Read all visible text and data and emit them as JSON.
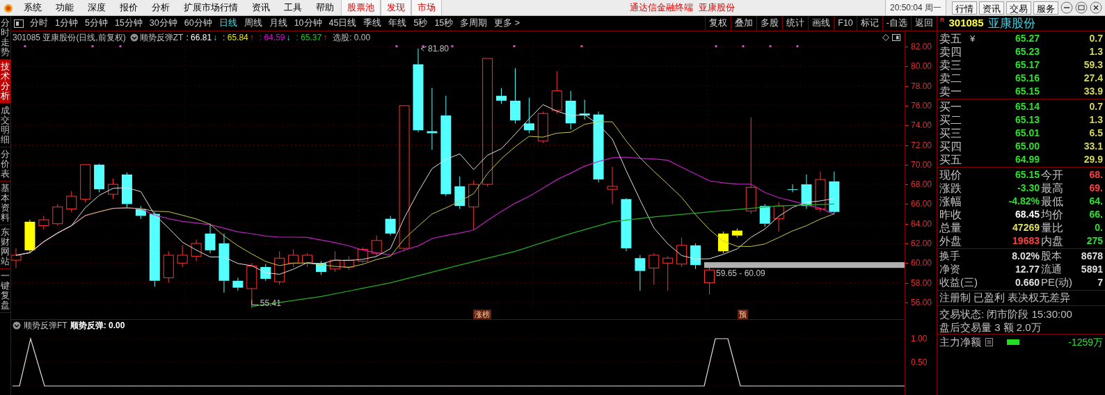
{
  "menu_bar": {
    "items": [
      {
        "label": "系统",
        "kind": "plain"
      },
      {
        "label": "功能",
        "kind": "plain"
      },
      {
        "label": "深度",
        "kind": "plain"
      },
      {
        "label": "报价",
        "kind": "plain"
      },
      {
        "label": "分析",
        "kind": "plain"
      },
      {
        "label": "扩展市场行情",
        "kind": "plain"
      },
      {
        "label": "资讯",
        "kind": "plain"
      },
      {
        "label": "工具",
        "kind": "plain"
      },
      {
        "label": "帮助",
        "kind": "plain"
      },
      {
        "label": "股票池",
        "kind": "red"
      },
      {
        "label": "发现",
        "kind": "red"
      },
      {
        "label": "市场",
        "kind": "red"
      }
    ],
    "title": "通达信金融终端",
    "title_stock": "亚康股份",
    "clock": "20:50:04 周一",
    "buttons": [
      "行情",
      "资讯",
      "交易",
      "服务"
    ]
  },
  "side_tabs": [
    {
      "label": "分时走势",
      "selected": false
    },
    {
      "label": "技术分析",
      "selected": true
    },
    {
      "label": "成交明细",
      "selected": false
    },
    {
      "label": "分价表",
      "selected": false
    },
    {
      "label": "基本资料",
      "selected": false
    },
    {
      "label": "东财网站",
      "selected": false
    },
    {
      "label": "一键复盘",
      "selected": false
    }
  ],
  "period_tabs": [
    {
      "label": "分时",
      "selected": false
    },
    {
      "label": "1分钟",
      "selected": false
    },
    {
      "label": "5分钟",
      "selected": false
    },
    {
      "label": "15分钟",
      "selected": false
    },
    {
      "label": "30分钟",
      "selected": false
    },
    {
      "label": "60分钟",
      "selected": false
    },
    {
      "label": "日线",
      "selected": true
    },
    {
      "label": "周线",
      "selected": false
    },
    {
      "label": "月线",
      "selected": false
    },
    {
      "label": "10分钟",
      "selected": false
    },
    {
      "label": "45日线",
      "selected": false
    },
    {
      "label": "季线",
      "selected": false
    },
    {
      "label": "年线",
      "selected": false
    },
    {
      "label": "5秒",
      "selected": false
    },
    {
      "label": "15秒",
      "selected": false
    },
    {
      "label": "多周期",
      "selected": false
    },
    {
      "label": "更多 >",
      "selected": false
    }
  ],
  "tool_buttons": [
    "复权",
    "叠加",
    "多股",
    "统计",
    "画线",
    "F10",
    "标记",
    "-自选",
    "返回"
  ],
  "main_chart": {
    "stock_title": "301085 亚康股份(日线,前复权)",
    "indicator_name": "顺势反弹ZT",
    "values": [
      {
        "value": ": 66.81",
        "arrow": "↓",
        "rising": false,
        "color": "#ffffff"
      },
      {
        "value": ": 65.84",
        "arrow": "↑",
        "rising": true,
        "color": "#e8e800"
      },
      {
        "value": ": 64.59",
        "arrow": "↓",
        "rising": false,
        "color": "#e000e0"
      },
      {
        "value": ": 65.37",
        "arrow": "↑",
        "rising": true,
        "color": "#00e000"
      }
    ],
    "select_label": "选股: 0.00",
    "y_axis_labels": [
      "82.00",
      "80.00",
      "78.00",
      "76.00",
      "74.00",
      "72.00",
      "70.00",
      "68.00",
      "66.00",
      "64.00",
      "62.00",
      "60.00",
      "58.00",
      "56.00"
    ],
    "high_note": "81.80",
    "low_note": "55.41",
    "range_note": "59.65 - 60.09",
    "markers": [
      {
        "label": "涨榜"
      },
      {
        "label": "预"
      }
    ]
  },
  "sub_chart": {
    "title": "顺势反弹FT",
    "line_label": "顺势反弹: 0.00",
    "y_axis_labels": [
      "1.00",
      "0.50"
    ]
  },
  "quote_panel": {
    "code": "301085",
    "name": "亚康股份",
    "mark": "R",
    "asks": [
      {
        "label": "卖五",
        "price": "65.27",
        "volume": "0.7"
      },
      {
        "label": "卖四",
        "price": "65.23",
        "volume": "1.3"
      },
      {
        "label": "卖三",
        "price": "65.17",
        "volume": "59.3"
      },
      {
        "label": "卖二",
        "price": "65.16",
        "volume": "27.4"
      },
      {
        "label": "卖一",
        "price": "65.15",
        "volume": "33.9"
      }
    ],
    "currency": "¥",
    "bids": [
      {
        "label": "买一",
        "price": "65.14",
        "volume": "0.7"
      },
      {
        "label": "买二",
        "price": "65.13",
        "volume": "1.3"
      },
      {
        "label": "买三",
        "price": "65.01",
        "volume": "6.5"
      },
      {
        "label": "买四",
        "price": "65.00",
        "volume": "33.1"
      },
      {
        "label": "买五",
        "price": "64.99",
        "volume": "29.9"
      }
    ],
    "stats": [
      {
        "left": {
          "label": "现价",
          "value": "65.15",
          "color": "#30e030"
        },
        "right": {
          "label": "今开",
          "value": "68.",
          "color": "#ff4040"
        }
      },
      {
        "left": {
          "label": "涨跌",
          "value": "-3.30",
          "color": "#30e030"
        },
        "right": {
          "label": "最高",
          "value": "69.",
          "color": "#ff4040"
        }
      },
      {
        "left": {
          "label": "涨幅",
          "value": "-4.82%",
          "color": "#30e030"
        },
        "right": {
          "label": "最低",
          "value": "64.",
          "color": "#30e030"
        }
      },
      {
        "left": {
          "label": "昨收",
          "value": "68.45",
          "color": "#ffffff"
        },
        "right": {
          "label": "均价",
          "value": "66.",
          "color": "#30e030"
        }
      },
      {
        "left": {
          "label": "总量",
          "value": "47269",
          "color": "#e0e060"
        },
        "right": {
          "label": "量比",
          "value": "0.",
          "color": "#30e030"
        }
      },
      {
        "left": {
          "label": "外盘",
          "value": "19683",
          "color": "#ff4040"
        },
        "right": {
          "label": "内盘",
          "value": "275",
          "color": "#30e030"
        }
      }
    ],
    "stats2": [
      {
        "label": "换手",
        "value": "8.02%",
        "label2": "股本",
        "value2": "8678"
      },
      {
        "label": "净资",
        "value": "12.77",
        "label2": "流通",
        "value2": "5891"
      },
      {
        "label": "收益(三)",
        "value": "0.660",
        "label2": "PE(动)",
        "value2": "7"
      }
    ],
    "notice": "注册制 已盈利 表决权无差异",
    "status": "交易状态: 闭市阶段 15:30:00",
    "after_hours": "盘后交易量 3 额 2.0万",
    "main_flow_label": "主力净额",
    "main_flow_value": "-1259万"
  }
}
